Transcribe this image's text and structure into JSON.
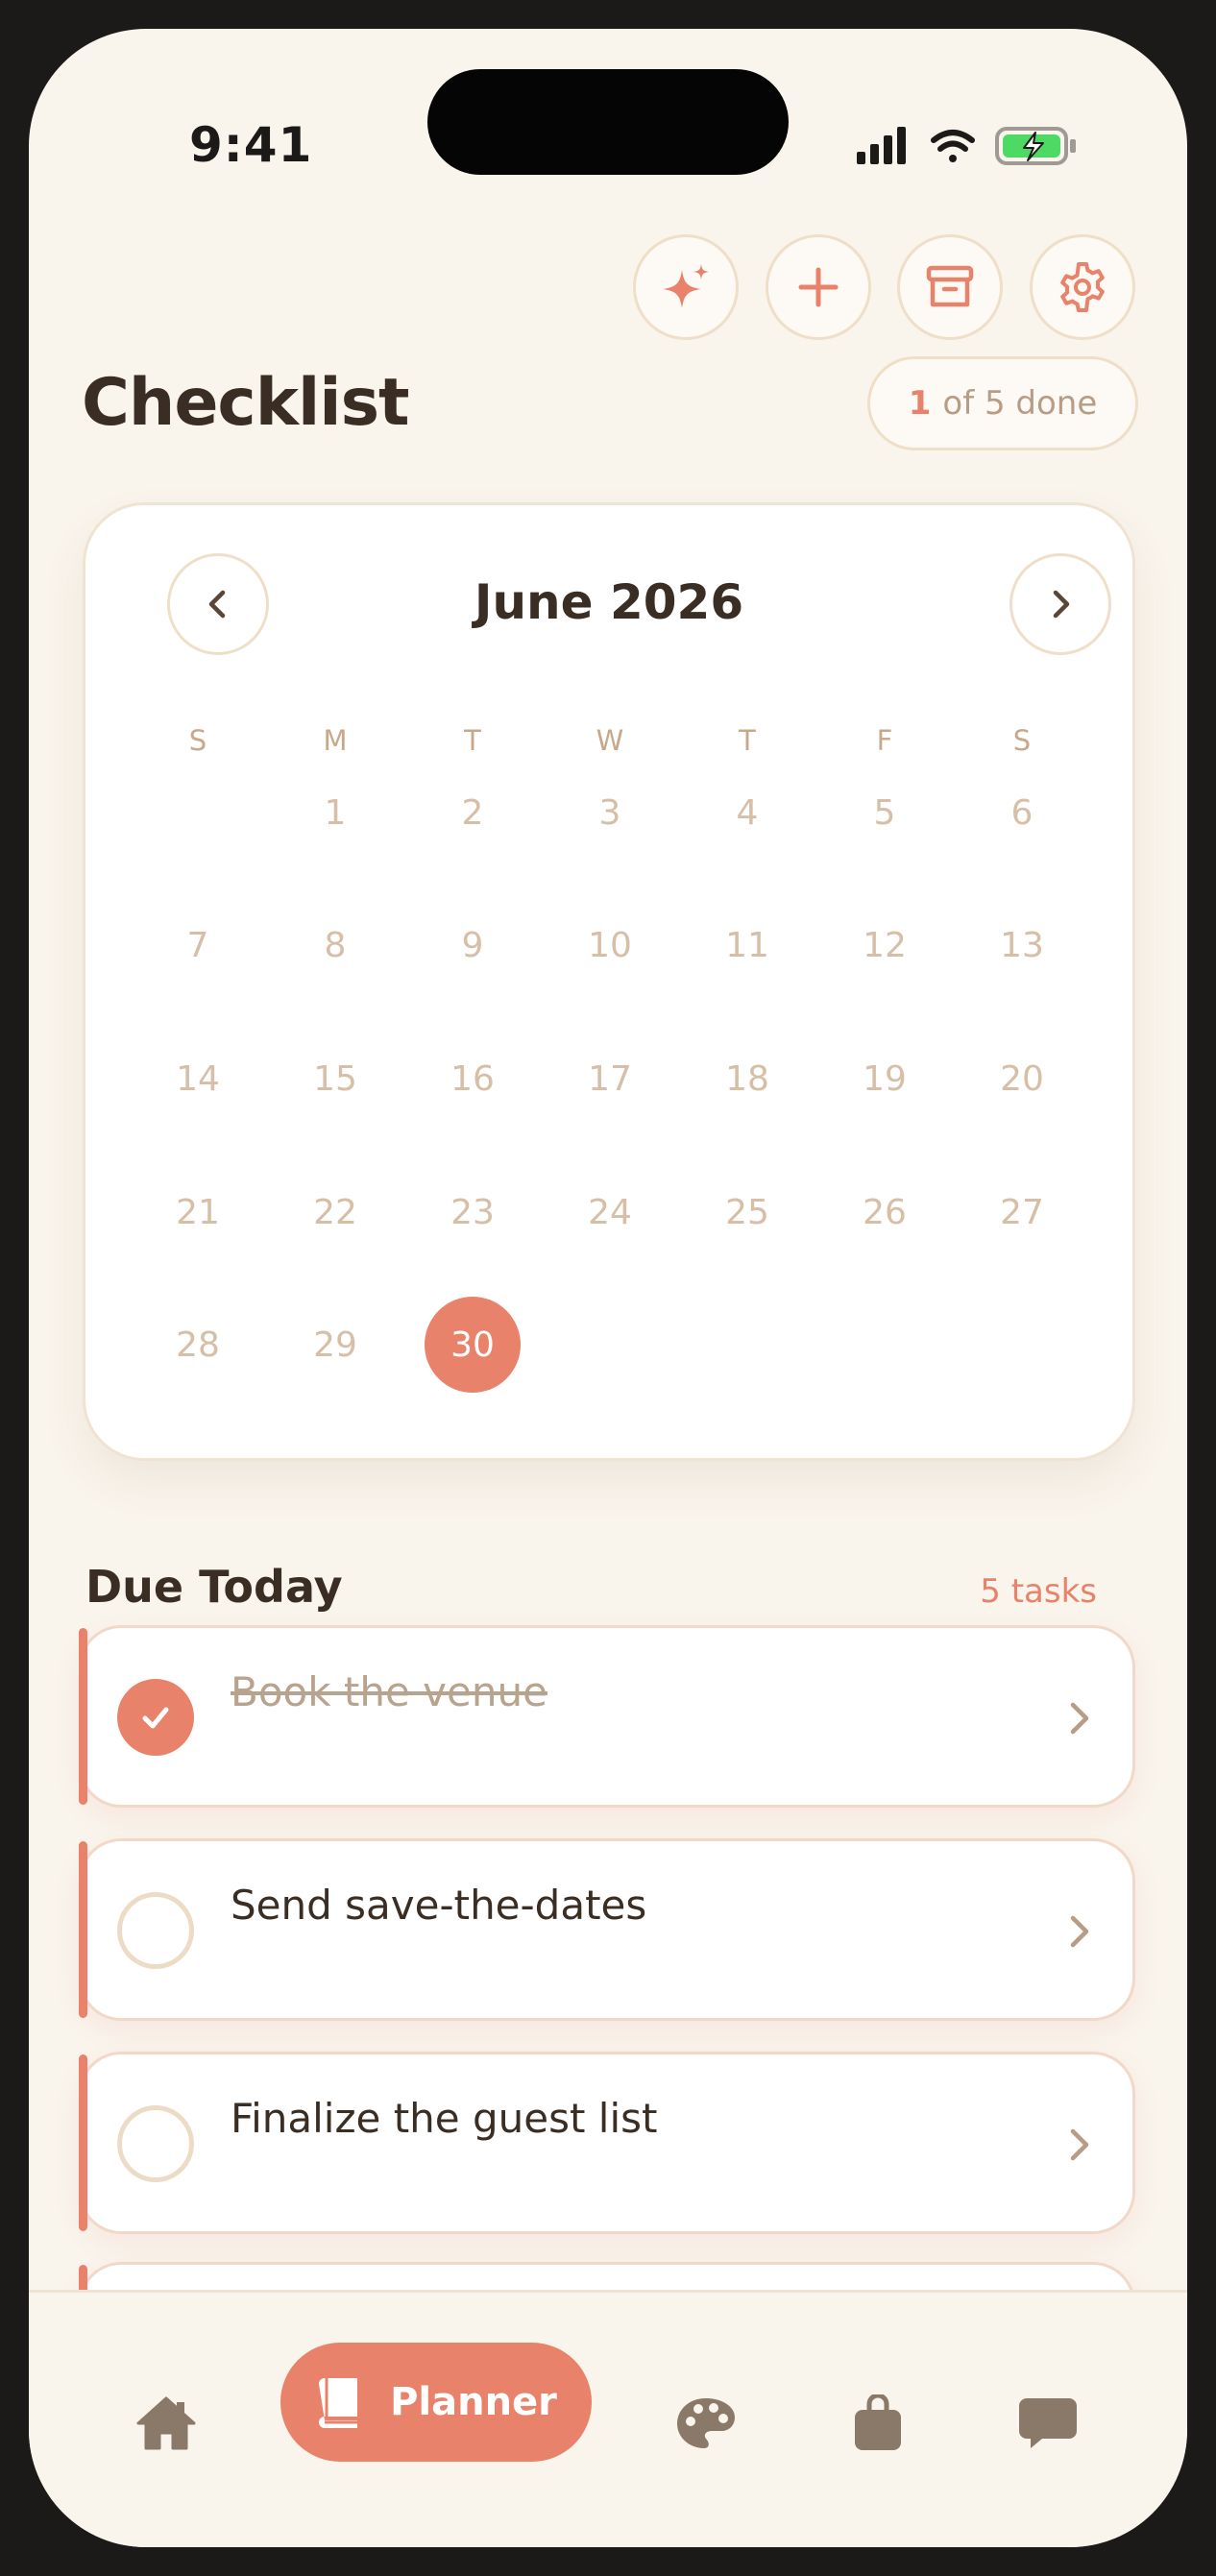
{
  "status_bar": {
    "time": "9:41"
  },
  "header": {
    "title": "Checklist",
    "progress": {
      "done": "1",
      "suffix": "of 5 done"
    },
    "actions": [
      "sparkles-icon",
      "plus-icon",
      "archive-icon",
      "gear-icon"
    ]
  },
  "calendar": {
    "month_label": "June 2026",
    "weekdays": [
      "S",
      "M",
      "T",
      "W",
      "T",
      "F",
      "S"
    ],
    "first_weekday": 1,
    "days_in_month": 30,
    "selected_day": 30
  },
  "due_today": {
    "title": "Due Today",
    "count_label": "5 tasks",
    "tasks": [
      {
        "label": "Book the venue",
        "done": true
      },
      {
        "label": "Send save-the-dates",
        "done": false
      },
      {
        "label": "Finalize the guest list",
        "done": false
      }
    ]
  },
  "bottom_nav": {
    "items": [
      "home-icon",
      "planner",
      "palette-icon",
      "bag-icon",
      "chat-icon"
    ],
    "active_label": "Planner"
  },
  "colors": {
    "accent": "#e8826a",
    "background": "#f9f4ec",
    "text_dark": "#3a2d23",
    "muted": "#d6bfa6"
  }
}
